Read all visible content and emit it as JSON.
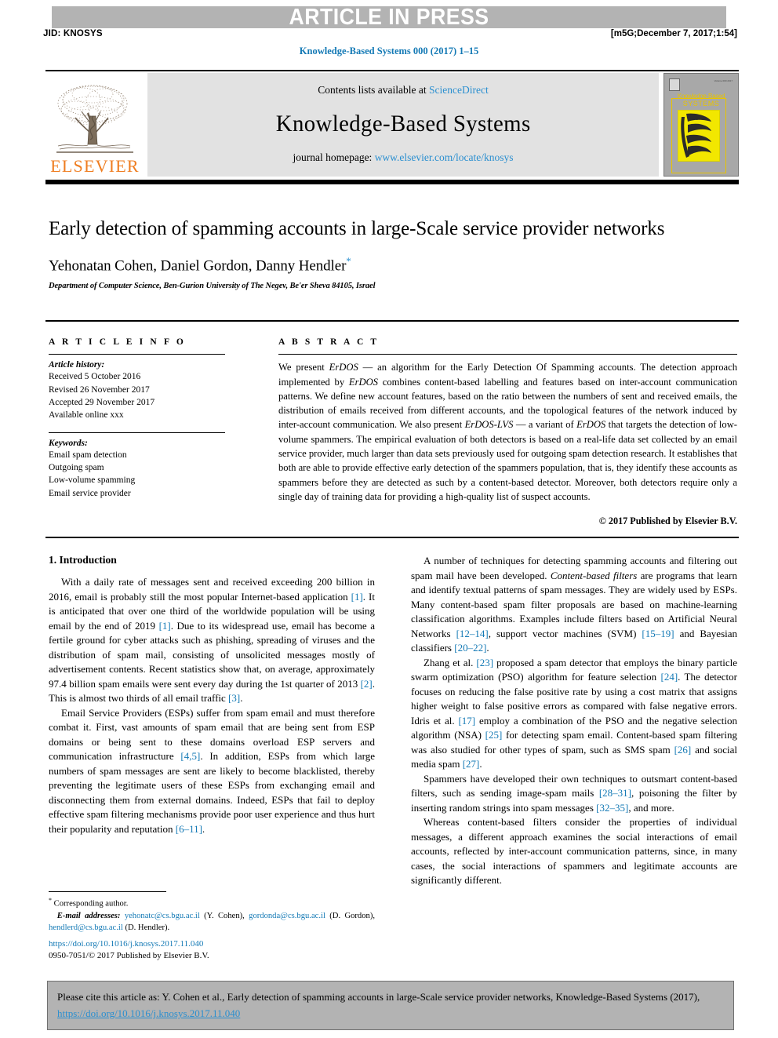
{
  "banner": {
    "text": "ARTICLE IN PRESS",
    "bg_color": "#b3b3b3"
  },
  "running_head": {
    "jid": "JID: KNOSYS",
    "stamp": "[m5G;December 7, 2017;1:54]"
  },
  "journal_reference": "Knowledge-Based Systems 000 (2017) 1–15",
  "masthead": {
    "publisher_name": "ELSEVIER",
    "contents_prefix": "Contents lists available at ",
    "contents_link": "ScienceDirect",
    "journal_name": "Knowledge-Based Systems",
    "homepage_prefix": "journal homepage: ",
    "homepage_link": "www.elsevier.com/locate/knosys",
    "cover": {
      "title_line1": "Knowledge-Based",
      "title_line2": "SYSTEMS",
      "tiny_top": "Volume 000 2017",
      "accent_color": "#f2e700",
      "title_color": "#e8c400"
    },
    "elsevier_orange": "#ef7d20",
    "link_color": "#2a8fd0"
  },
  "article": {
    "title": "Early detection of spamming accounts in large-Scale service provider networks",
    "authors": "Yehonatan Cohen, Daniel Gordon, Danny Hendler",
    "author_marker": "*",
    "affiliation": "Department of Computer Science, Ben-Gurion University of The Negev, Be'er Sheva 84105, Israel"
  },
  "article_info": {
    "heading": "A R T I C L E    I N F O",
    "history_label": "Article history:",
    "history": [
      "Received 5 October 2016",
      "Revised 26 November 2017",
      "Accepted 29 November 2017",
      "Available online xxx"
    ],
    "keywords_label": "Keywords:",
    "keywords": [
      "Email spam detection",
      "Outgoing spam",
      "Low-volume spamming",
      "Email service provider"
    ]
  },
  "abstract": {
    "heading": "A B S T R A C T",
    "paragraphs": [
      "We present ErDOS — an algorithm for the Early Detection Of Spamming accounts. The detection approach implemented by ErDOS combines content-based labelling and features based on inter-account communication patterns. We define new account features, based on the ratio between the numbers of sent and received emails, the distribution of emails received from different accounts, and the topological features of the network induced by inter-account communication. We also present ErDOS-LVS — a variant of ErDOS that targets the detection of low-volume spammers. The empirical evaluation of both detectors is based on a real-life data set collected by an email service provider, much larger than data sets previously used for outgoing spam detection research. It establishes that both are able to provide effective early detection of the spammers population, that is, they identify these accounts as spammers before they are detected as such by a content-based detector. Moreover, both detectors require only a single day of training data for providing a high-quality list of suspect accounts."
    ],
    "copyright": "© 2017 Published by Elsevier B.V."
  },
  "body": {
    "section_number_title": "1. Introduction",
    "left_paragraphs": [
      "With a daily rate of messages sent and received exceeding 200 billion in 2016, email is probably still the most popular Internet-based application [1]. It is anticipated that over one third of the worldwide population will be using email by the end of 2019 [1]. Due to its widespread use, email has become a fertile ground for cyber attacks such as phishing, spreading of viruses and the distribution of spam mail, consisting of unsolicited messages mostly of advertisement contents. Recent statistics show that, on average, approximately 97.4 billion spam emails were sent every day during the 1st quarter of 2013 [2]. This is almost two thirds of all email traffic [3].",
      "Email Service Providers (ESPs) suffer from spam email and must therefore combat it. First, vast amounts of spam email that are being sent from ESP domains or being sent to these domains overload ESP servers and communication infrastructure [4,5]. In addition, ESPs from which large numbers of spam messages are sent are likely to become blacklisted, thereby preventing the legitimate users of these ESPs from exchanging email and disconnecting them from external domains. Indeed, ESPs that fail to deploy effective spam filtering mechanisms provide poor user experience and thus hurt their popularity and reputation [6–11]."
    ],
    "right_paragraphs": [
      "A number of techniques for detecting spamming accounts and filtering out spam mail have been developed. Content-based filters are programs that learn and identify textual patterns of spam messages. They are widely used by ESPs. Many content-based spam filter proposals are based on machine-learning classification algorithms. Examples include filters based on Artificial Neural Networks [12–14], support vector machines (SVM) [15–19] and Bayesian classifiers [20–22].",
      "Zhang et al. [23] proposed a spam detector that employs the binary particle swarm optimization (PSO) algorithm for feature selection [24]. The detector focuses on reducing the false positive rate by using a cost matrix that assigns higher weight to false positive errors as compared with false negative errors. Idris et al. [17] employ a combination of the PSO and the negative selection algorithm (NSA) [25] for detecting spam email. Content-based spam filtering was also studied for other types of spam, such as SMS spam [26] and social media spam [27].",
      "Spammers have developed their own techniques to outsmart content-based filters, such as sending image-spam mails [28–31], poisoning the filter by inserting random strings into spam messages [32–35], and more.",
      "Whereas content-based filters consider the properties of individual messages, a different approach examines the social interactions of email accounts, reflected by inter-account communication patterns, since, in many cases, the social interactions of spammers and legitimate accounts are significantly different."
    ]
  },
  "footnote": {
    "corresponding": "Corresponding author.",
    "email_label": "E-mail addresses:",
    "emails": [
      {
        "address": "yehonatc@cs.bgu.ac.il",
        "name": "(Y. Cohen)"
      },
      {
        "address": "gordonda@cs.bgu.ac.il",
        "name": "(D. Gordon)"
      },
      {
        "address": "hendlerd@cs.bgu.ac.il",
        "name": "(D. Hendler)."
      }
    ]
  },
  "doi_block": {
    "doi": "https://doi.org/10.1016/j.knosys.2017.11.040",
    "issn_line": "0950-7051/© 2017 Published by Elsevier B.V."
  },
  "cite_box": {
    "prefix": "Please cite this article as: Y. Cohen et al., Early detection of spamming accounts in large-Scale service provider networks, Knowledge-Based Systems (2017), ",
    "link": "https://doi.org/10.1016/j.knosys.2017.11.040",
    "bg_color": "#b3b3b3"
  }
}
